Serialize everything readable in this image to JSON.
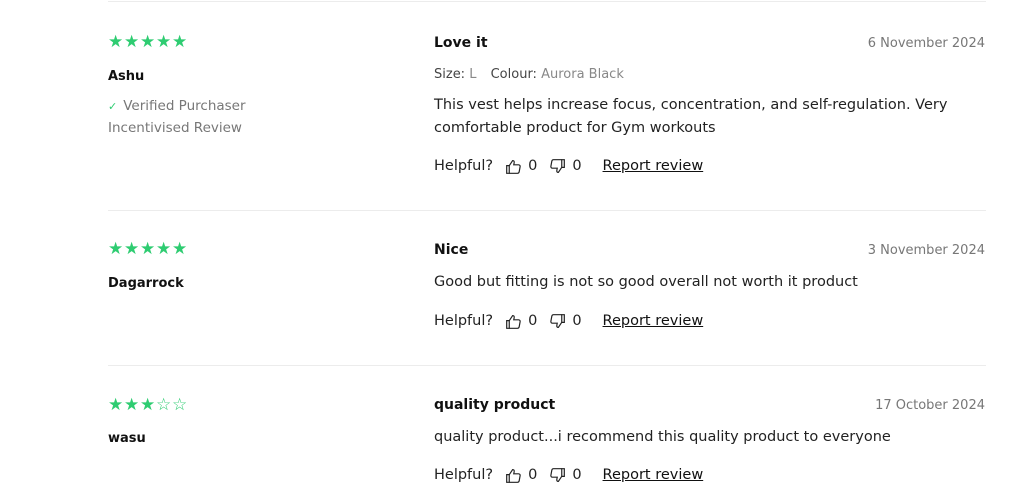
{
  "reviews": [
    {
      "stars": [
        "★",
        "★",
        "★",
        "★",
        "★"
      ],
      "author": "Ashu",
      "verified": "Verified Purchaser",
      "incentivised": "Incentivised Review",
      "title": "Love it",
      "date": "6 November 2024",
      "size_label": "Size:",
      "size_value": "L",
      "colour_label": "Colour:",
      "colour_value": "Aurora Black",
      "body_line1": "This vest helps increase focus, concentration, and self-regulation. Very",
      "body_line2": "comfortable product for Gym workouts",
      "helpful_label": "Helpful?",
      "up_count": "0",
      "down_count": "0",
      "report_label": "Report review"
    },
    {
      "stars": [
        "★",
        "★",
        "★",
        "★",
        "★"
      ],
      "author": "Dagarrock",
      "title": "Nice",
      "date": "3 November 2024",
      "body_line1": "Good but fitting is not so good overall not worth it product",
      "helpful_label": "Helpful?",
      "up_count": "0",
      "down_count": "0",
      "report_label": "Report review"
    },
    {
      "stars": [
        "★",
        "★",
        "★",
        "☆",
        "☆"
      ],
      "author": "wasu",
      "title": "quality product",
      "date": "17 October 2024",
      "body_line1": "quality product...i recommend this quality product to everyone",
      "helpful_label": "Helpful?",
      "up_count": "0",
      "down_count": "0",
      "report_label": "Report review"
    }
  ],
  "colors": {
    "star": "#2ecc71",
    "muted": "#777777",
    "divider": "#ececec"
  },
  "icons": {
    "thumbs_up": "thumbs-up-icon",
    "thumbs_down": "thumbs-down-icon",
    "verified": "check-icon"
  }
}
